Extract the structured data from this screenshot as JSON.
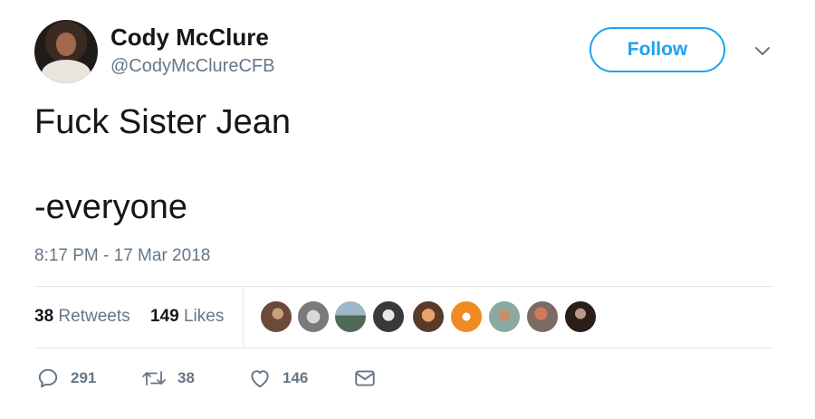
{
  "user": {
    "name": "Cody McClure",
    "handle": "@CodyMcClureCFB"
  },
  "follow_label": "Follow",
  "tweet": {
    "line1": "Fuck Sister Jean",
    "line2": "-everyone"
  },
  "timestamp": "8:17 PM - 17 Mar 2018",
  "stats": {
    "retweets_count": "38",
    "retweets_label": "Retweets",
    "likes_count": "149",
    "likes_label": "Likes"
  },
  "actions": {
    "replies": "291",
    "retweets": "38",
    "likes": "146"
  },
  "icons": [
    "chevron-down-icon",
    "reply-icon",
    "retweet-icon",
    "heart-icon",
    "mail-icon"
  ],
  "colors": {
    "accent": "#1da1f2",
    "secondary_text": "#657786",
    "divider": "#e1e8ed"
  }
}
